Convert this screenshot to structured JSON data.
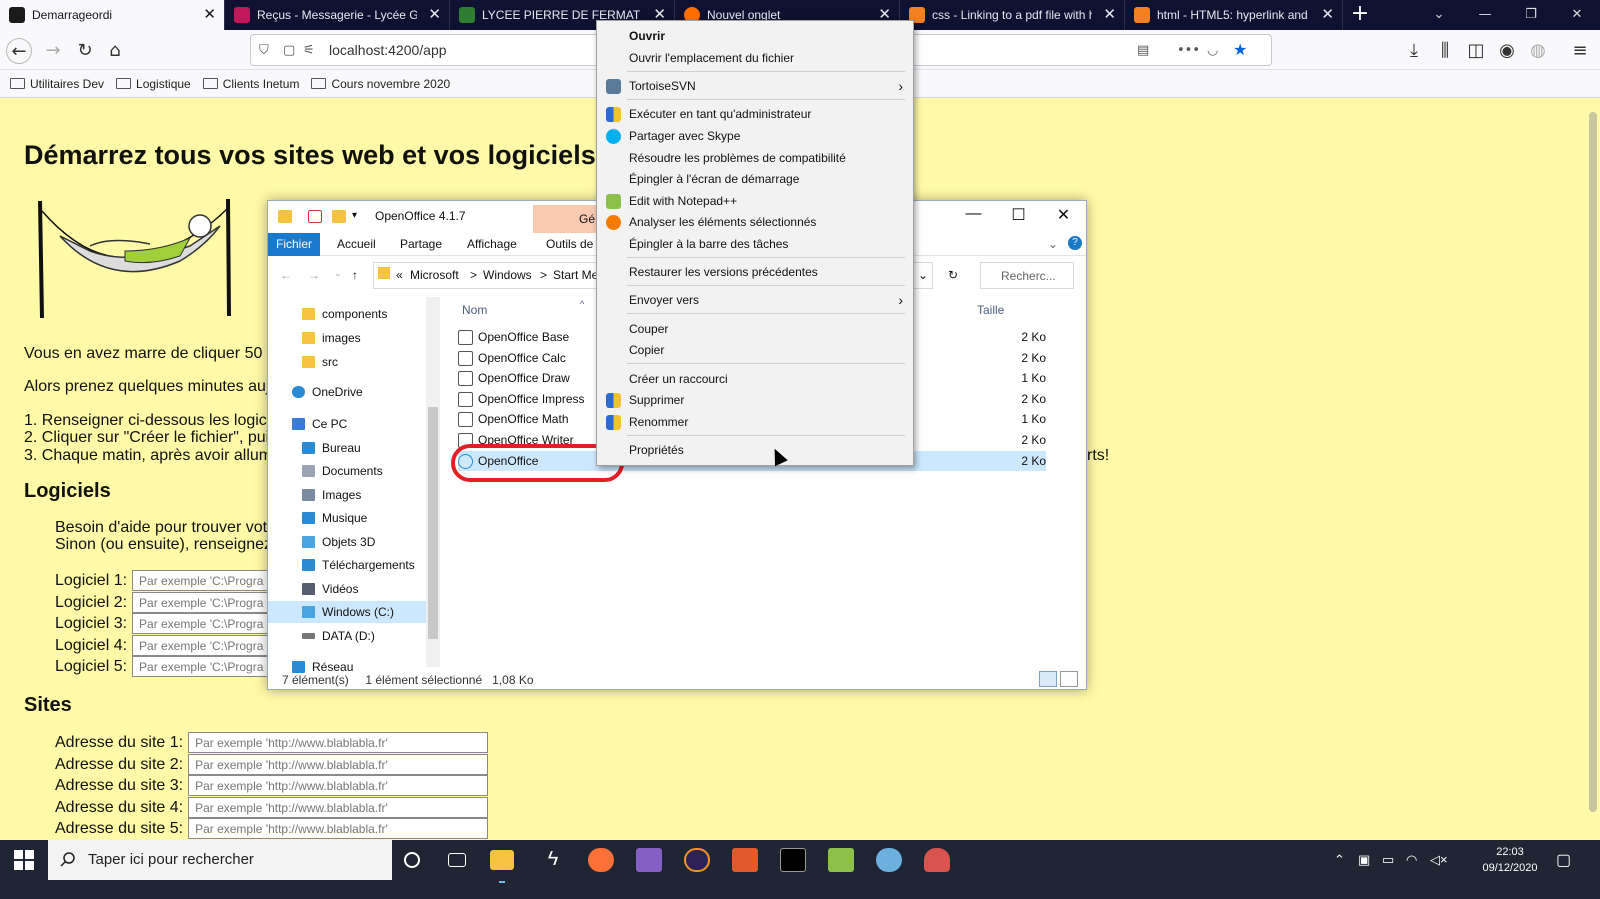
{
  "browser": {
    "tabs": [
      {
        "label": "Demarrageordi",
        "active": true,
        "favicon_color": "#1b1b1b"
      },
      {
        "label": "Reçus - Messagerie - Lycée Gén",
        "active": false,
        "favicon_color": "#c2185b"
      },
      {
        "label": "LYCEE PIERRE DE FERMAT - PR",
        "active": false,
        "favicon_color": "#2e7d32"
      },
      {
        "label": "Nouvel onglet",
        "active": false,
        "favicon_color": "#ff6d00"
      },
      {
        "label": "css - Linking to a pdf file with h",
        "active": false,
        "favicon_color": "#f48024"
      },
      {
        "label": "html - HTML5: hyperlink and m",
        "active": false,
        "favicon_color": "#f48024"
      }
    ],
    "url": "localhost:4200/app",
    "bookmarks": [
      "Utilitaires Dev",
      "Logistique",
      "Clients Inetum",
      "Cours novembre 2020"
    ]
  },
  "page": {
    "title": "Démarrez tous vos sites web et vos logiciels",
    "intro1": "Vous en avez marre de cliquer 50 f",
    "intro2": "Alors prenez quelques minutes auj",
    "steps": [
      "1. Renseigner ci-dessous les logici",
      "2. Cliquer sur \"Créer le fichier\", puis",
      "3. Chaque matin, après avoir allum"
    ],
    "steps_tail": "rts!",
    "logiciels_heading": "Logiciels",
    "help1": "Besoin d'aide pour trouver votr",
    "help2": "Sinon (ou ensuite), renseignez",
    "logiciels": [
      {
        "label": "Logiciel 1:",
        "placeholder": "Par exemple 'C:\\Progra"
      },
      {
        "label": "Logiciel 2:",
        "placeholder": "Par exemple 'C:\\Progra"
      },
      {
        "label": "Logiciel 3:",
        "placeholder": "Par exemple 'C:\\Progra"
      },
      {
        "label": "Logiciel 4:",
        "placeholder": "Par exemple 'C:\\Progra"
      },
      {
        "label": "Logiciel 5:",
        "placeholder": "Par exemple 'C:\\Progra"
      }
    ],
    "sites_heading": "Sites",
    "sites": [
      {
        "label": "Adresse du site 1:",
        "placeholder": "Par exemple 'http://www.blablabla.fr'"
      },
      {
        "label": "Adresse du site 2:",
        "placeholder": "Par exemple 'http://www.blablabla.fr'"
      },
      {
        "label": "Adresse du site 3:",
        "placeholder": "Par exemple 'http://www.blablabla.fr'"
      },
      {
        "label": "Adresse du site 4:",
        "placeholder": "Par exemple 'http://www.blablabla.fr'"
      },
      {
        "label": "Adresse du site 5:",
        "placeholder": "Par exemple 'http://www.blablabla.fr'"
      }
    ]
  },
  "explorer": {
    "title": "OpenOffice 4.1.7",
    "context_tab": "Gé",
    "ribbon_tabs": [
      "Fichier",
      "Accueil",
      "Partage",
      "Affichage",
      "Outils de"
    ],
    "breadcrumbs": [
      "«",
      "Microsoft",
      ">",
      "Windows",
      ">",
      "Start Me"
    ],
    "search_placeholder": "Recherc...",
    "nav": [
      {
        "label": "components",
        "color": "#f5c242"
      },
      {
        "label": "images",
        "color": "#f5c242"
      },
      {
        "label": "src",
        "color": "#f5c242"
      },
      {
        "label": "OneDrive",
        "color": "#2a8ad4"
      },
      {
        "label": "Ce PC",
        "color": "#3a7bd5"
      },
      {
        "label": "Bureau",
        "color": "#2a8ad4"
      },
      {
        "label": "Documents",
        "color": "#9aa4b2"
      },
      {
        "label": "Images",
        "color": "#7a8aa0"
      },
      {
        "label": "Musique",
        "color": "#2a8ad4"
      },
      {
        "label": "Objets 3D",
        "color": "#4aa4e0"
      },
      {
        "label": "Téléchargements",
        "color": "#2a8ad4"
      },
      {
        "label": "Vidéos",
        "color": "#555f6e"
      },
      {
        "label": "Windows (C:)",
        "color": "#4aa4e0"
      },
      {
        "label": "DATA (D:)",
        "color": "#777"
      },
      {
        "label": "Réseau",
        "color": "#2a8ad4"
      }
    ],
    "columns": {
      "name": "Nom",
      "size": "Taille"
    },
    "files": [
      {
        "name": "OpenOffice Base",
        "size": "2 Ko"
      },
      {
        "name": "OpenOffice Calc",
        "size": "2 Ko"
      },
      {
        "name": "OpenOffice Draw",
        "size": "1 Ko"
      },
      {
        "name": "OpenOffice Impress",
        "size": "2 Ko"
      },
      {
        "name": "OpenOffice Math",
        "size": "1 Ko"
      },
      {
        "name": "OpenOffice Writer",
        "size": "2 Ko"
      },
      {
        "name": "OpenOffice",
        "size": "2 Ko"
      }
    ],
    "status_count": "7 élément(s)",
    "status_selected": "1 élément sélectionné",
    "status_size": "1,08 Ko"
  },
  "context_menu": {
    "items": [
      {
        "label": "Ouvrir",
        "bold": true
      },
      {
        "label": "Ouvrir l'emplacement du fichier"
      },
      {
        "label": "TortoiseSVN",
        "submenu": true,
        "icon": "tortoise-icon"
      },
      {
        "label": "Exécuter en tant qu'administrateur",
        "icon": "shield-icon"
      },
      {
        "label": "Partager avec Skype",
        "icon": "skype-icon"
      },
      {
        "label": "Résoudre les problèmes de compatibilité"
      },
      {
        "label": "Épingler à l'écran de démarrage"
      },
      {
        "label": "Edit with Notepad++",
        "icon": "notepad-icon"
      },
      {
        "label": "Analyser les éléments sélectionnés",
        "icon": "avast-icon"
      },
      {
        "label": "Épingler à la barre des tâches"
      },
      {
        "label": "Restaurer les versions précédentes"
      },
      {
        "label": "Envoyer vers",
        "submenu": true
      },
      {
        "label": "Couper"
      },
      {
        "label": "Copier"
      },
      {
        "label": "Créer un raccourci"
      },
      {
        "label": "Supprimer",
        "icon": "shield-icon"
      },
      {
        "label": "Renommer",
        "icon": "shield-icon"
      },
      {
        "label": "Propriétés"
      }
    ]
  },
  "taskbar": {
    "search_placeholder": "Taper ici pour rechercher",
    "time": "22:03",
    "date": "09/12/2020"
  },
  "colors": {
    "page_bg": "#fffaa8",
    "accent_blue": "#1979ca",
    "highlight_red": "#e41e26",
    "selection": "#cce8ff"
  }
}
